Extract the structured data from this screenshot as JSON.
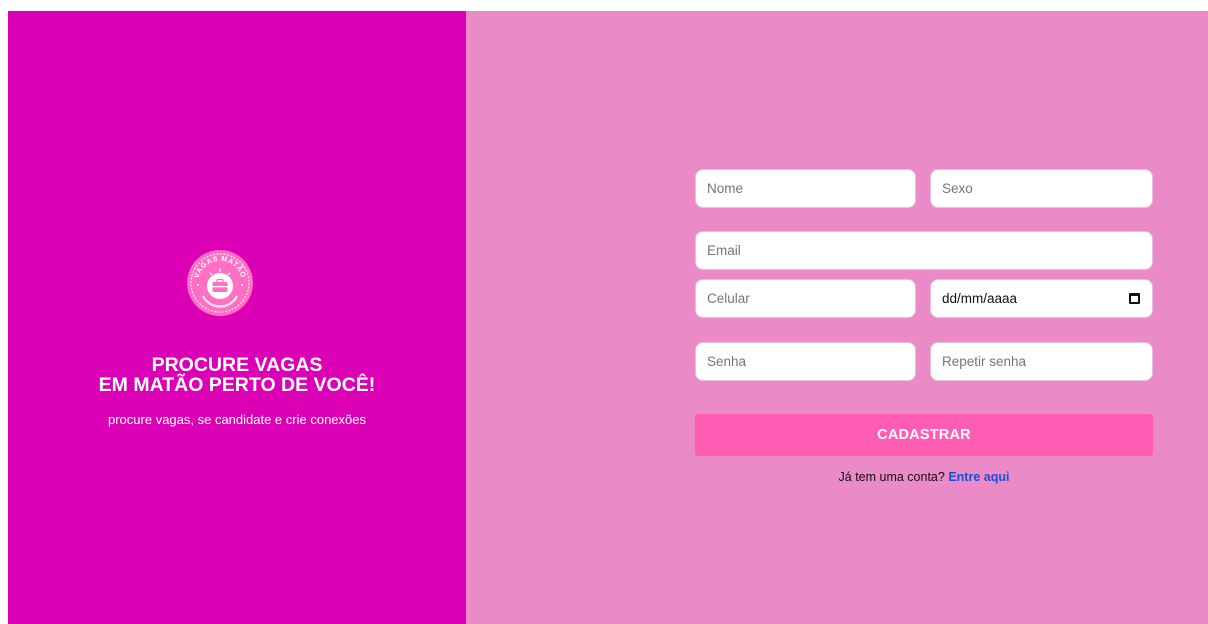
{
  "colors": {
    "left_panel": "#db00b6",
    "right_panel": "#ea8ac6",
    "button": "#ff5cb3",
    "link": "#1c4fd6"
  },
  "brand": {
    "logo_text": "VAGAS MATÃO",
    "logo_icon": "briefcase-icon",
    "headline_line1": "PROCURE VAGAS",
    "headline_line2": "EM MATÃO PERTO DE VOCÊ!",
    "subtitle": "procure vagas, se candidate e crie conexões"
  },
  "form": {
    "nome_placeholder": "Nome",
    "sexo_placeholder": "Sexo",
    "email_placeholder": "Email",
    "celular_placeholder": "Celular",
    "date_value": "dd/mm/aaaa",
    "date_icon": "calendar-icon",
    "senha_placeholder": "Senha",
    "repetir_senha_placeholder": "Repetir senha",
    "submit_label": "CADASTRAR"
  },
  "login": {
    "prompt": "Já tem uma conta?",
    "link_label": "Entre aqui"
  }
}
